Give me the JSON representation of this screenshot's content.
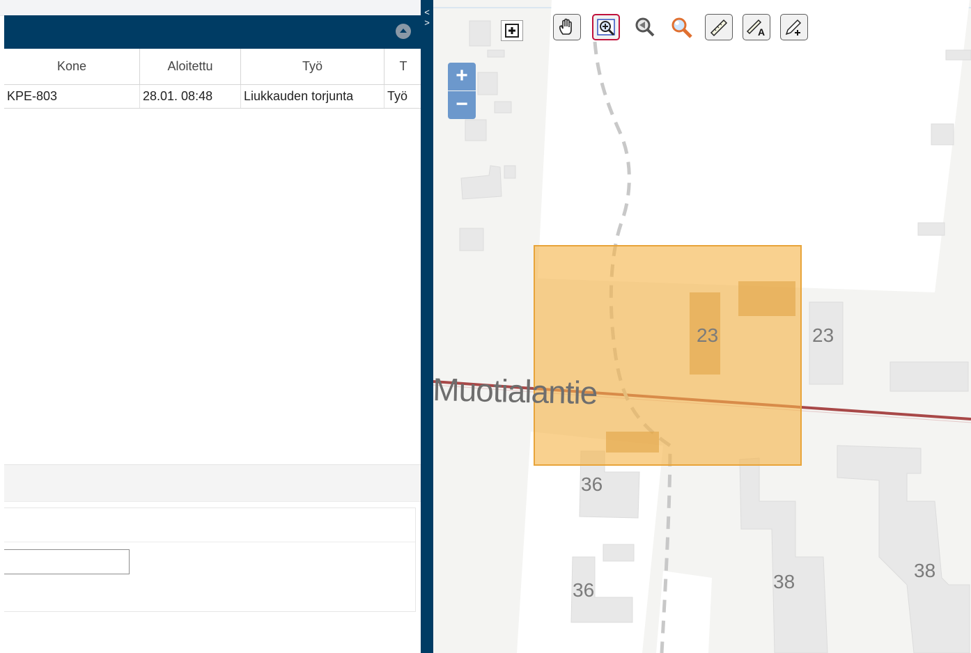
{
  "grid": {
    "columns": [
      "Kone",
      "Aloitettu",
      "Työ",
      "T"
    ],
    "rows": [
      {
        "kone": "KPE-803",
        "aloitettu": "28.01. 08:48",
        "tyo": "Liukkauden torjunta",
        "t": "Työ"
      }
    ]
  },
  "splitter": {
    "arrows": "<\n>"
  },
  "map": {
    "zoom_in": "+",
    "zoom_out": "−",
    "street_name": "Muotialantie",
    "house_numbers": [
      "23",
      "23",
      "36",
      "36",
      "38",
      "38"
    ],
    "highlight_color": "#f5b54a",
    "road_color": "#a84848"
  },
  "icons": {
    "toolbar": [
      "layer-add-icon",
      "pan-hand-icon",
      "zoom-box-icon",
      "zoom-previous-icon",
      "query-icon",
      "measure-line-icon",
      "measure-area-icon",
      "draw-icon"
    ]
  }
}
